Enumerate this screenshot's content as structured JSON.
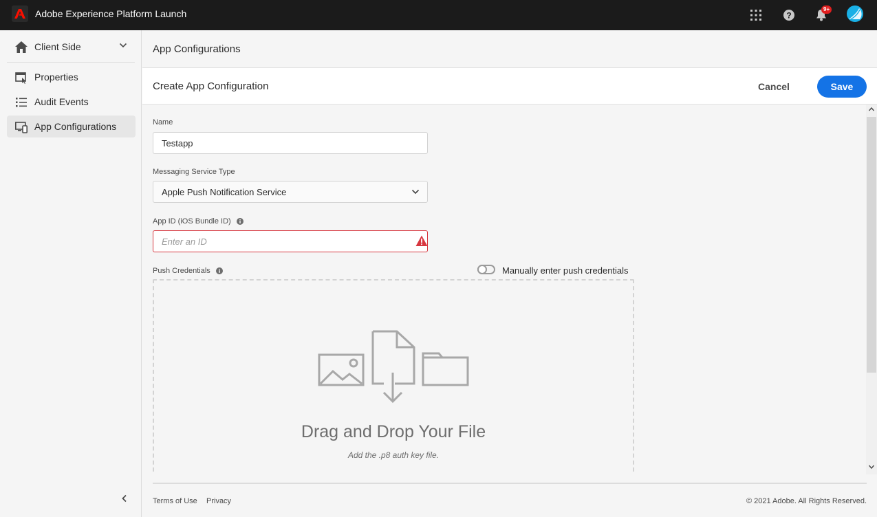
{
  "topbar": {
    "app_title": "Adobe Experience Platform Launch",
    "notification_badge": "9+",
    "icons": [
      "adobe-logo-icon",
      "apps-grid-icon",
      "help-icon",
      "bell-icon",
      "avatar"
    ]
  },
  "sidebar": {
    "header_label": "Client Side",
    "items": [
      {
        "label": "Properties",
        "icon": "properties-icon",
        "active": false
      },
      {
        "label": "Audit Events",
        "icon": "list-icon",
        "active": false
      },
      {
        "label": "App Configurations",
        "icon": "devices-icon",
        "active": true
      }
    ]
  },
  "main": {
    "title": "App Configurations",
    "panel_title": "Create App Configuration",
    "cancel_label": "Cancel",
    "save_label": "Save"
  },
  "form": {
    "name_label": "Name",
    "name_value": "Testapp",
    "service_label": "Messaging Service Type",
    "service_value": "Apple Push Notification Service",
    "appid_label": "App ID (iOS Bundle ID)",
    "appid_value": "",
    "appid_placeholder": "Enter an ID",
    "credentials_label": "Push Credentials",
    "manual_toggle_label": "Manually enter push credentials",
    "manual_toggle_on": false,
    "dropzone_title": "Drag and Drop Your File",
    "dropzone_subtitle": "Add the .p8 auth key file."
  },
  "footer": {
    "terms": "Terms of Use",
    "privacy": "Privacy",
    "copyright": "© 2021 Adobe. All Rights Reserved."
  },
  "colors": {
    "topbar_bg": "#1b1b1b",
    "accent": "#1473e6",
    "error": "#d7373f",
    "adobe_red": "#fa0f00",
    "avatar": "#19b0e6"
  }
}
